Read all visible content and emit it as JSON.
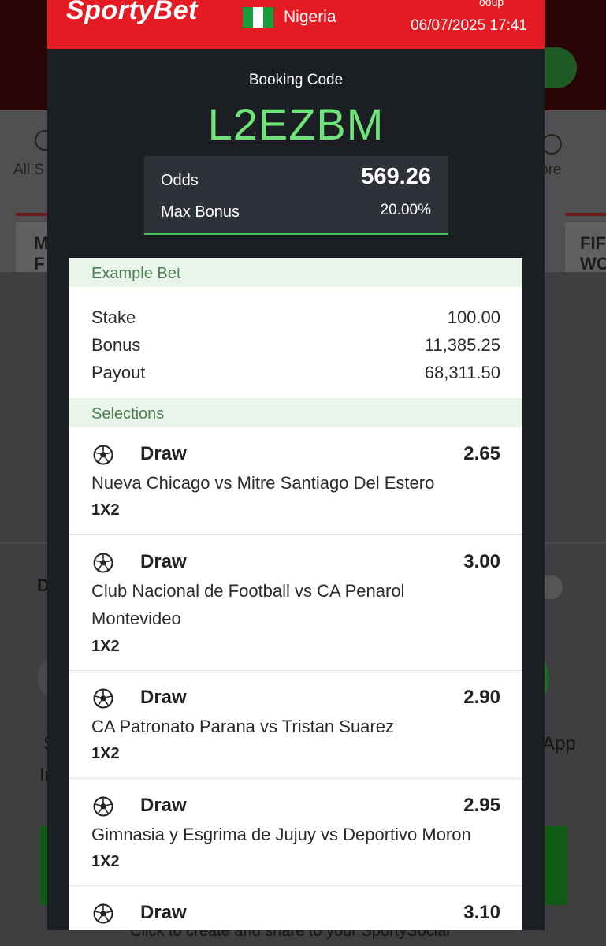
{
  "header": {
    "brand": "SportyBet",
    "country": "Nigeria",
    "datetime": "06/07/2025 17:41",
    "top_fragment": "ooup"
  },
  "booking": {
    "label": "Booking Code",
    "code": "L2EZBM",
    "odds_label": "Odds",
    "odds_value": "569.26",
    "bonus_label": "Max Bonus",
    "bonus_value": "20.00%"
  },
  "example_bet": {
    "title": "Example Bet",
    "rows": [
      {
        "label": "Stake",
        "value": "100.00"
      },
      {
        "label": "Bonus",
        "value": "11,385.25"
      },
      {
        "label": "Payout",
        "value": "68,311.50"
      }
    ]
  },
  "selections": {
    "title": "Selections",
    "items": [
      {
        "pick": "Draw",
        "odds": "2.65",
        "match": "Nueva Chicago vs Mitre Santiago Del Estero",
        "market": "1X2"
      },
      {
        "pick": "Draw",
        "odds": "3.00",
        "match": "Club Nacional de Football vs CA Penarol Montevideo",
        "market": "1X2"
      },
      {
        "pick": "Draw",
        "odds": "2.90",
        "match": "CA Patronato Parana vs Tristan Suarez",
        "market": "1X2"
      },
      {
        "pick": "Draw",
        "odds": "2.95",
        "match": "Gimnasia y Esgrima de Jujuy vs Deportivo Moron",
        "market": "1X2"
      },
      {
        "pick": "Draw",
        "odds": "3.10"
      }
    ]
  },
  "background": {
    "nav_left": "All S",
    "nav_right": "ore",
    "card_left": "M\nF",
    "card_right": "FIF\nWO",
    "left_letter": "D",
    "side_letter_1": "S",
    "side_letter_2": "In",
    "side_app": "App",
    "footer_text": "Click to create and share to your SportySocial"
  },
  "colors": {
    "brand_red": "#e41b23",
    "code_green": "#6fe37a",
    "card_dark": "#1b1e23",
    "section_bg": "#e9f4ea",
    "section_text": "#4d7f55"
  },
  "icons": {
    "selection": "football-icon"
  }
}
